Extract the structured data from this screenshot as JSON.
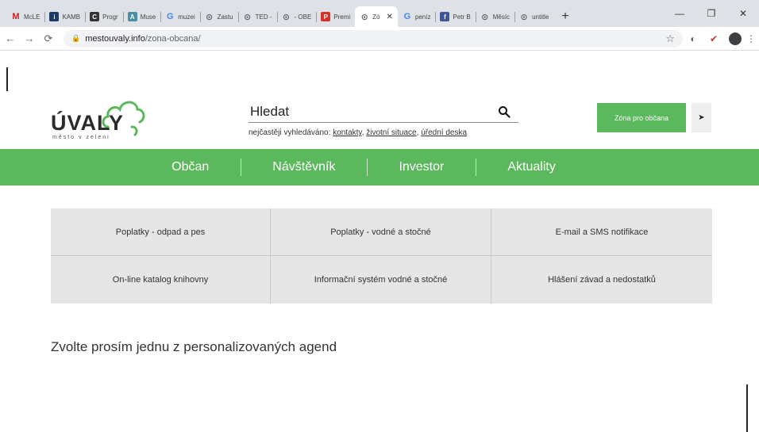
{
  "browser": {
    "tabs": [
      {
        "label": "McLE",
        "icon": "gmail-icon",
        "color": "#c5221f",
        "glyph": "M"
      },
      {
        "label": "KAMB",
        "icon": "kamba-icon",
        "color": "#1a3a6b",
        "glyph": "i"
      },
      {
        "label": "Progr",
        "icon": "progress-icon",
        "color": "#333333",
        "glyph": "C"
      },
      {
        "label": "Muse",
        "icon": "museum-icon",
        "color": "#4a90a4",
        "glyph": "A"
      },
      {
        "label": "muzei",
        "icon": "google-icon",
        "color": "#4285f4",
        "glyph": "G"
      },
      {
        "label": "Zastu",
        "icon": "globe-icon",
        "color": "#5f6368",
        "glyph": "⊙"
      },
      {
        "label": "TED -",
        "icon": "globe-icon",
        "color": "#5f6368",
        "glyph": "⊙"
      },
      {
        "label": "- OBE",
        "icon": "globe-icon",
        "color": "#5f6368",
        "glyph": "⊙"
      },
      {
        "label": "Premi",
        "icon": "premier-icon",
        "color": "#d93025",
        "glyph": "P"
      },
      {
        "label": "Zó",
        "icon": "globe-icon",
        "color": "#5f6368",
        "glyph": "⊙",
        "active": true
      },
      {
        "label": "peníz",
        "icon": "google-icon",
        "color": "#4285f4",
        "glyph": "G"
      },
      {
        "label": "Petr B",
        "icon": "facebook-icon",
        "color": "#3b5998",
        "glyph": "f"
      },
      {
        "label": "Měsíc",
        "icon": "globe-icon",
        "color": "#5f6368",
        "glyph": "⊙"
      },
      {
        "label": "untitle",
        "icon": "globe-icon",
        "color": "#5f6368",
        "glyph": "⊙"
      }
    ],
    "new_tab": "+",
    "url_host": "mestouvaly.info",
    "url_path": "/zona-obcana/"
  },
  "header": {
    "logo_text": "ÚVALY",
    "logo_sub": "město v zeleni",
    "search_placeholder": "Hledat",
    "frequent_label": "nejčastěji vyhledáváno:",
    "frequent_links": [
      "kontakty",
      "životní situace",
      "úřední deska"
    ],
    "zone_button": "Zóna pro občana"
  },
  "nav": {
    "items": [
      "Občan",
      "Návštěvník",
      "Investor",
      "Aktuality"
    ]
  },
  "services": [
    "Poplatky - odpad a pes",
    "Poplatky - vodné a stočné",
    "E-mail a SMS notifikace",
    "On-line katalog knihovny",
    "Informační systém vodné a stočné",
    "Hlášení závad a nedostatků"
  ],
  "main": {
    "prompt": "Zvolte prosím jednu z personalizovaných agend"
  },
  "colors": {
    "brand_green": "#5cb85c",
    "tile_gray": "#e6e6e6"
  }
}
